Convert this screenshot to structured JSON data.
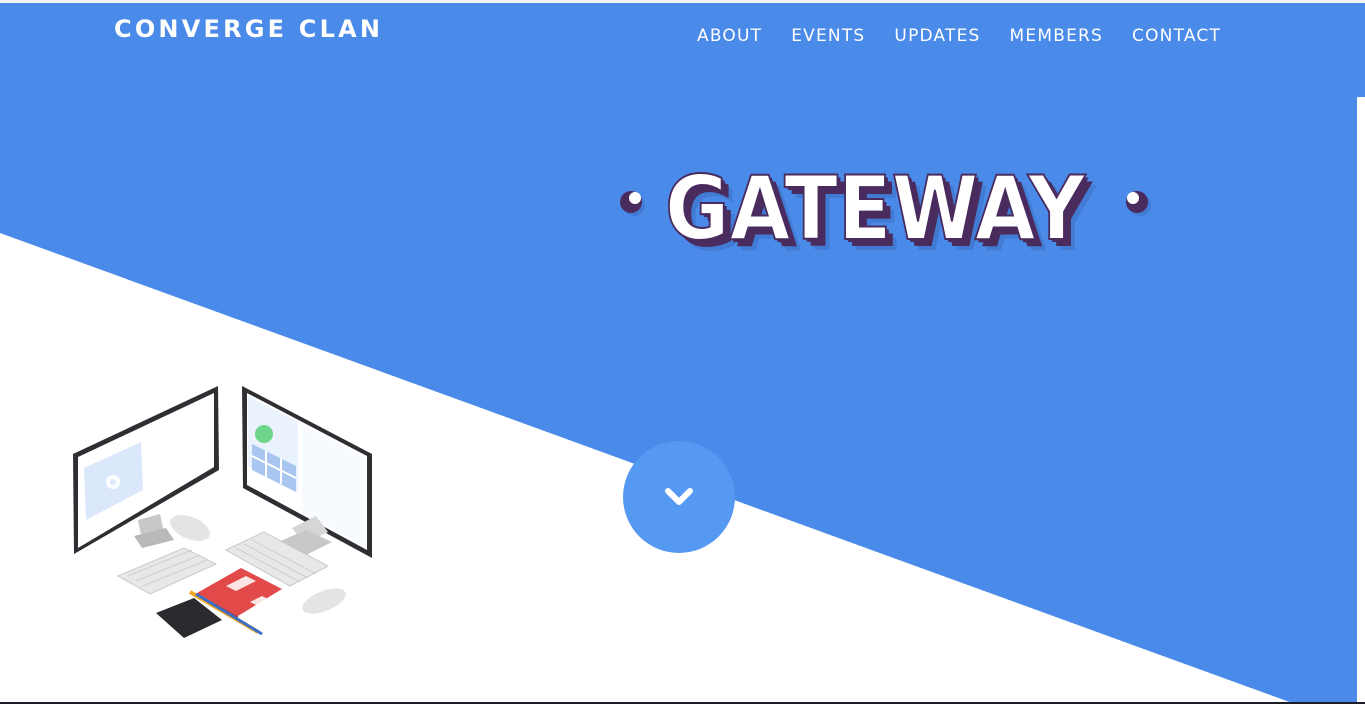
{
  "brand": {
    "name": "CONVERGE CLAN"
  },
  "nav": {
    "items": [
      {
        "label": "ABOUT"
      },
      {
        "label": "EVENTS"
      },
      {
        "label": "UPDATES"
      },
      {
        "label": "MEMBERS"
      },
      {
        "label": "CONTACT"
      }
    ]
  },
  "hero": {
    "logo_text": "GATEWAY",
    "scroll_icon": "chevron-down-icon",
    "illustration": "workspace-desk-illustration"
  },
  "colors": {
    "primary_blue": "#4a8ae8",
    "button_blue": "#5699f3",
    "logo_face": "#ffffff",
    "logo_shadow": "#4a2b5e",
    "logo_drop": "#3c6fc4"
  }
}
